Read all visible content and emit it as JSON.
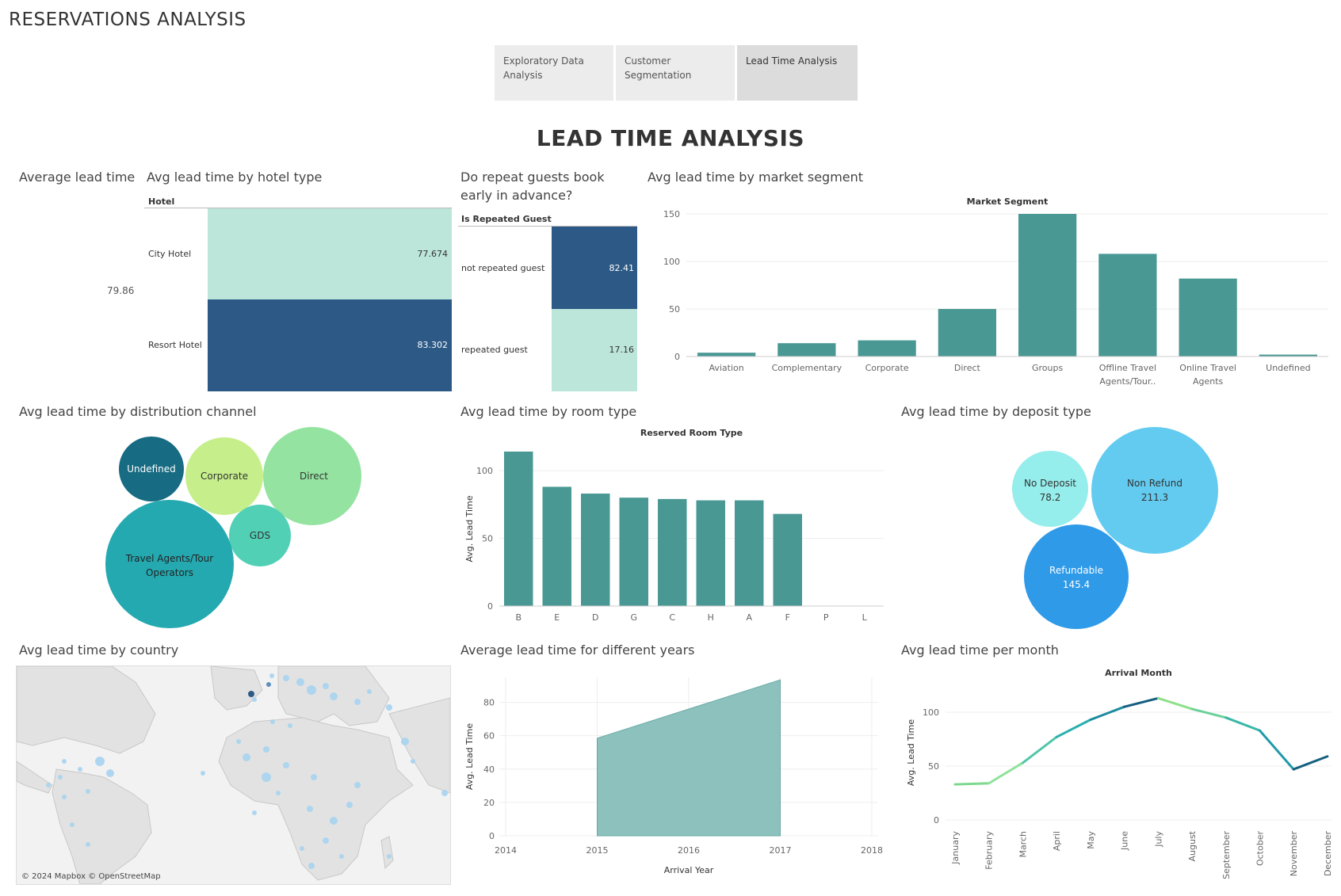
{
  "app_title": "RESERVATIONS ANALYSIS",
  "tabs": [
    {
      "label": "Exploratory Data Analysis"
    },
    {
      "label": "Customer Segmentation"
    },
    {
      "label": "Lead Time Analysis"
    }
  ],
  "dashboard_title": "LEAD TIME ANALYSIS",
  "colors": {
    "light_green": "#bde6db",
    "dark_blue": "#2d5986",
    "teal": "#4a9893",
    "light_aqua": "#bde6db"
  },
  "panels": {
    "average_lead_time": {
      "title": "Average lead time",
      "value": "79.86"
    },
    "hotel_type": {
      "title": "Avg lead time by hotel type",
      "header": "Hotel",
      "rows": [
        {
          "label": "City Hotel",
          "value": "77.674"
        },
        {
          "label": "Resort Hotel",
          "value": "83.302"
        }
      ]
    },
    "repeat_guests": {
      "title": "Do repeat guests book early in advance?",
      "header": "Is Repeated Guest",
      "rows": [
        {
          "label": "not repeated guest",
          "value": "82.41"
        },
        {
          "label": "repeated guest",
          "value": "17.16"
        }
      ]
    },
    "market_segment": {
      "title": "Avg lead time by market segment"
    },
    "distribution_channel": {
      "title": "Avg lead time by distribution channel",
      "bubbles": [
        {
          "label": "Undefined",
          "color": "#176b82"
        },
        {
          "label": "Corporate",
          "color": "#c6ef8c"
        },
        {
          "label": "Direct",
          "color": "#94e3a0"
        },
        {
          "label": "GDS",
          "color": "#52d0b6"
        },
        {
          "label": "Travel Agents/Tour Operators",
          "color": "#25a9b0"
        }
      ]
    },
    "room_type": {
      "title": "Avg lead time by room type"
    },
    "deposit_type": {
      "title": "Avg lead time by deposit type",
      "bubbles": [
        {
          "label": "No Deposit",
          "value": "78.2",
          "color": "#95eeec"
        },
        {
          "label": "Non Refund",
          "value": "211.3",
          "color": "#62cbef"
        },
        {
          "label": "Refundable",
          "value": "145.4",
          "color": "#2f9ae8"
        }
      ]
    },
    "country": {
      "title": "Avg lead time by country",
      "attribution": "© 2024 Mapbox © OpenStreetMap"
    },
    "years": {
      "title": "Average lead time for different years"
    },
    "month": {
      "title": "Avg lead time per month"
    }
  },
  "chart_data": [
    {
      "id": "market_segment",
      "type": "bar",
      "title": "Market Segment",
      "categories": [
        "Aviation",
        "Complementary",
        "Corporate",
        "Direct",
        "Groups",
        "Offline Travel Agents/Tour..",
        "Online Travel Agents",
        "Undefined"
      ],
      "values": [
        4,
        14,
        17,
        50,
        150,
        108,
        82,
        2
      ],
      "ylim": [
        0,
        150
      ],
      "yticks": [
        0,
        50,
        100,
        150
      ],
      "grid": true
    },
    {
      "id": "room_type",
      "type": "bar",
      "title": "Reserved Room Type",
      "ylabel": "Avg. Lead Time",
      "categories": [
        "B",
        "E",
        "D",
        "G",
        "C",
        "H",
        "A",
        "F",
        "P",
        "L"
      ],
      "values": [
        114,
        88,
        83,
        80,
        79,
        78,
        78,
        68,
        0,
        0
      ],
      "ylim": [
        0,
        114
      ],
      "yticks": [
        0,
        50,
        100
      ],
      "grid": true
    },
    {
      "id": "years",
      "type": "area",
      "xlabel": "Arrival Year",
      "ylabel": "Avg. Lead Time",
      "x": [
        2015,
        2016,
        2017
      ],
      "values": [
        58.5,
        76,
        93.5
      ],
      "xticks": [
        2014,
        2015,
        2016,
        2017,
        2018
      ],
      "yticks": [
        0,
        20,
        40,
        60,
        80
      ],
      "grid": true
    },
    {
      "id": "month",
      "type": "line",
      "title": "Arrival Month",
      "ylabel": "Avg. Lead Time",
      "categories": [
        "January",
        "February",
        "March",
        "April",
        "May",
        "June",
        "July",
        "August",
        "September",
        "October",
        "November",
        "December"
      ],
      "values": [
        33,
        34,
        53,
        77,
        93,
        105,
        113,
        103,
        95,
        83,
        47,
        59
      ],
      "yticks": [
        0,
        50,
        100
      ],
      "grid": true
    }
  ]
}
